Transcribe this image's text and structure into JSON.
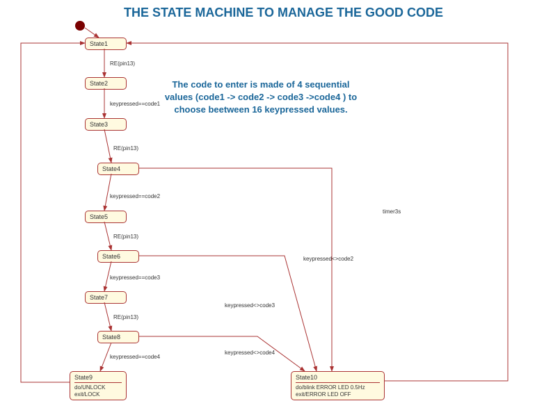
{
  "title": "THE STATE MACHINE TO MANAGE THE GOOD CODE",
  "description": "The code to enter is made of 4 sequential values (code1 -> code2 -> code3 ->code4 ) to choose beetween 16 keypressed values.",
  "states": {
    "s1": {
      "name": "State1"
    },
    "s2": {
      "name": "State2"
    },
    "s3": {
      "name": "State3"
    },
    "s4": {
      "name": "State4"
    },
    "s5": {
      "name": "State5"
    },
    "s6": {
      "name": "State6"
    },
    "s7": {
      "name": "State7"
    },
    "s8": {
      "name": "State8"
    },
    "s9": {
      "name": "State9",
      "actions": "do/UNLOCK\nexit/LOCK"
    },
    "s10": {
      "name": "State10",
      "actions": "do/blink ERROR LED 0.5Hz\nexit/ERROR LED OFF"
    }
  },
  "labels": {
    "t_1_2": "RE(pin13)",
    "t_2_3": "keypressed==code1",
    "t_3_4": "RE(pin13)",
    "t_4_5": "keypressed==code2",
    "t_5_6": "RE(pin13)",
    "t_6_7": "keypressed==code3",
    "t_7_8": "RE(pin13)",
    "t_8_9": "keypressed==code4",
    "t_4_10": "keypressed<>code2",
    "t_6_10": "keypressed<>code3",
    "t_8_10": "keypressed<>code4",
    "t_timer": "timer3s"
  },
  "chart_data": {
    "type": "state_machine",
    "initial": "State1",
    "nodes": [
      {
        "id": "State1"
      },
      {
        "id": "State2"
      },
      {
        "id": "State3"
      },
      {
        "id": "State4"
      },
      {
        "id": "State5"
      },
      {
        "id": "State6"
      },
      {
        "id": "State7"
      },
      {
        "id": "State8"
      },
      {
        "id": "State9",
        "do": "UNLOCK",
        "exit": "LOCK"
      },
      {
        "id": "State10",
        "do": "blink ERROR LED 0.5Hz",
        "exit": "ERROR LED OFF"
      }
    ],
    "edges": [
      {
        "from": "__initial__",
        "to": "State1"
      },
      {
        "from": "State1",
        "to": "State2",
        "guard": "RE(pin13)"
      },
      {
        "from": "State2",
        "to": "State3",
        "guard": "keypressed==code1"
      },
      {
        "from": "State3",
        "to": "State4",
        "guard": "RE(pin13)"
      },
      {
        "from": "State4",
        "to": "State5",
        "guard": "keypressed==code2"
      },
      {
        "from": "State5",
        "to": "State6",
        "guard": "RE(pin13)"
      },
      {
        "from": "State6",
        "to": "State7",
        "guard": "keypressed==code3"
      },
      {
        "from": "State7",
        "to": "State8",
        "guard": "RE(pin13)"
      },
      {
        "from": "State8",
        "to": "State9",
        "guard": "keypressed==code4"
      },
      {
        "from": "State4",
        "to": "State10",
        "guard": "keypressed<>code2"
      },
      {
        "from": "State6",
        "to": "State10",
        "guard": "keypressed<>code3"
      },
      {
        "from": "State8",
        "to": "State10",
        "guard": "keypressed<>code4"
      },
      {
        "from": "State10",
        "to": "State1",
        "guard": "timer3s"
      },
      {
        "from": "State9",
        "to": "State1"
      }
    ]
  }
}
